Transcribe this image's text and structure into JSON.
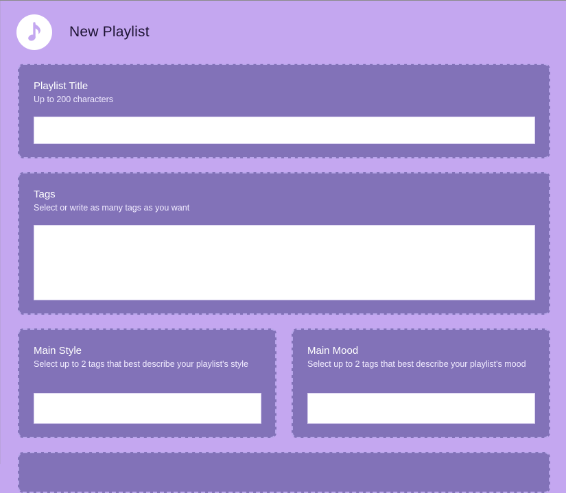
{
  "header": {
    "title": "New Playlist",
    "icon": "music-note-icon"
  },
  "sections": {
    "playlist_title": {
      "label": "Playlist Title",
      "hint": "Up to 200 characters",
      "value": ""
    },
    "tags": {
      "label": "Tags",
      "hint": "Select or write as many tags as you want",
      "value": ""
    },
    "main_style": {
      "label": "Main Style",
      "hint": "Select up to 2 tags that best describe your playlist's style",
      "value": ""
    },
    "main_mood": {
      "label": "Main Mood",
      "hint": "Select up to 2 tags that best describe your playlist's mood",
      "value": ""
    }
  },
  "colors": {
    "background": "#c4a7f0",
    "card": "#8272b8",
    "card_border": "#b9a6ea",
    "text_light": "#ffffff"
  }
}
